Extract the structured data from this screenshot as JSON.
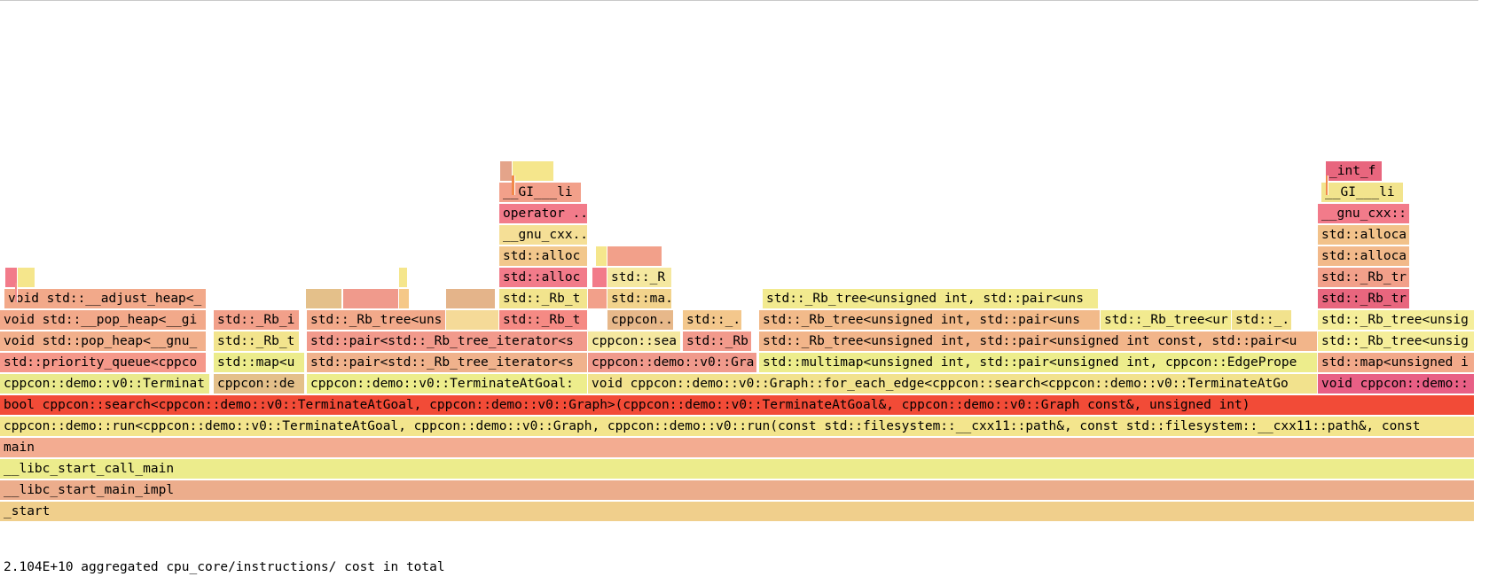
{
  "footer": {
    "total_text": "2.104E+10 aggregated cpu_core/instructions/ cost in total"
  },
  "frames": [
    {
      "label": "_start",
      "color": "#f0cf8c"
    },
    {
      "label": "__libc_start_main_impl",
      "color": "#ecad8c"
    },
    {
      "label": "__libc_start_call_main",
      "color": "#ecec8c"
    },
    {
      "label": "main",
      "color": "#f3ac91"
    },
    {
      "label": "cppcon::demo::run<cppcon::demo::v0::TerminateAtGoal, cppcon::demo::v0::Graph, cppcon::demo::v0::run(const std::filesystem::__cxx11::path&, const std::filesystem::__cxx11::path&, const",
      "color": "#f3e58d"
    },
    {
      "label": "bool cppcon::search<cppcon::demo::v0::TerminateAtGoal, cppcon::demo::v0::Graph>(cppcon::demo::v0::TerminateAtGoal&, cppcon::demo::v0::Graph const&, unsigned int)",
      "color": "#f24b37"
    },
    {
      "label": "cppcon::demo::v0::Terminat",
      "color": "#eaea8c"
    },
    {
      "label": "cppcon::de",
      "color": "#e4c08a"
    },
    {
      "label": "cppcon::demo::v0::TerminateAtGoal:",
      "color": "#eded8c"
    },
    {
      "label": "void cppcon::demo::v0::Graph::for_each_edge<cppcon::search<cppcon::demo::v0::TerminateAtGo",
      "color": "#f2e28d"
    },
    {
      "label": "void cppcon::demo::",
      "color": "#e85f85"
    },
    {
      "label": "std::priority_queue<cppco",
      "color": "#f5988a"
    },
    {
      "label": "std::map<u",
      "color": "#ecec8c"
    },
    {
      "label": "std::pair<std::_Rb_tree_iterator<s",
      "color": "#f0b28c"
    },
    {
      "label": "cppcon::demo::v0::Gra",
      "color": "#f09a8c"
    },
    {
      "label": "std::multimap<unsigned int, std::pair<unsigned int, cppcon::EdgePrope",
      "color": "#eded8c"
    },
    {
      "label": "std::map<unsigned i",
      "color": "#f2a98a"
    },
    {
      "label": "void std::pop_heap<__gnu_",
      "color": "#f2b08c"
    },
    {
      "label": "std::_Rb_t",
      "color": "#f2e48d"
    },
    {
      "label": "std::pair<std::_Rb_tree_iterator<s",
      "color": "#f29a8c"
    },
    {
      "label": "cppcon::sea",
      "color": "#f5e8a0"
    },
    {
      "label": "std::_Rb",
      "color": "#f29a8c"
    },
    {
      "label": "std::_Rb_tree<unsigned int, std::pair<unsigned int const, std::pair<u",
      "color": "#f2b58a"
    },
    {
      "label": "std::_Rb_tree<unsig",
      "color": "#f5ee9a"
    },
    {
      "label": "void std::__pop_heap<__gi",
      "color": "#f2a98a"
    },
    {
      "label": "std::_Rb_i",
      "color": "#f2a08a"
    },
    {
      "label": "std::_Rb_tree<uns",
      "color": "#f2a98a"
    },
    {
      "label": "std::_Rb_t",
      "color": "#f58a84"
    },
    {
      "label": "cppcon...",
      "color": "#e7b88a"
    },
    {
      "label": "std::_.",
      "color": "#f3c78c"
    },
    {
      "label": "std::_Rb_tree<unsigned int, std::pair<uns",
      "color": "#f2ba8a"
    },
    {
      "label": "std::_Rb_tree<ur",
      "color": "#f2ea8f"
    },
    {
      "label": "std::_.",
      "color": "#f2e28d"
    },
    {
      "label": "std::_Rb_tree<unsig",
      "color": "#f5ee9a"
    },
    {
      "label": "void std::__adjust_heap<_",
      "color": "#f2a98a"
    },
    {
      "label": "std::_Rb_t",
      "color": "#f2e48d"
    },
    {
      "label": "std::ma.",
      "color": "#f2d38c"
    },
    {
      "label": "std::_Rb_tree<unsigned int, std::pair<uns",
      "color": "#f2ea8f"
    },
    {
      "label": "std::_Rb_tr",
      "color": "#e8667e"
    },
    {
      "label": "std::alloc",
      "color": "#f27b8a"
    },
    {
      "label": "std::_R",
      "color": "#f5e8a0"
    },
    {
      "label": "std::_Rb_tr",
      "color": "#f2a08a"
    },
    {
      "label": "std::alloc",
      "color": "#f2c78c"
    },
    {
      "label": "std::alloca",
      "color": "#f2b98a"
    },
    {
      "label": "__gnu_cxx...",
      "color": "#f5df96"
    },
    {
      "label": "std::alloca",
      "color": "#f2c28a"
    },
    {
      "label": "operator ...",
      "color": "#f27b8a"
    },
    {
      "label": "__gnu_cxx::",
      "color": "#f27b8a"
    },
    {
      "label": "__GI___li",
      "color": "#f2a08a"
    },
    {
      "label": "__GI___li",
      "color": "#f2e48d"
    },
    {
      "label": "_int_f",
      "color": "#e8667e"
    }
  ]
}
